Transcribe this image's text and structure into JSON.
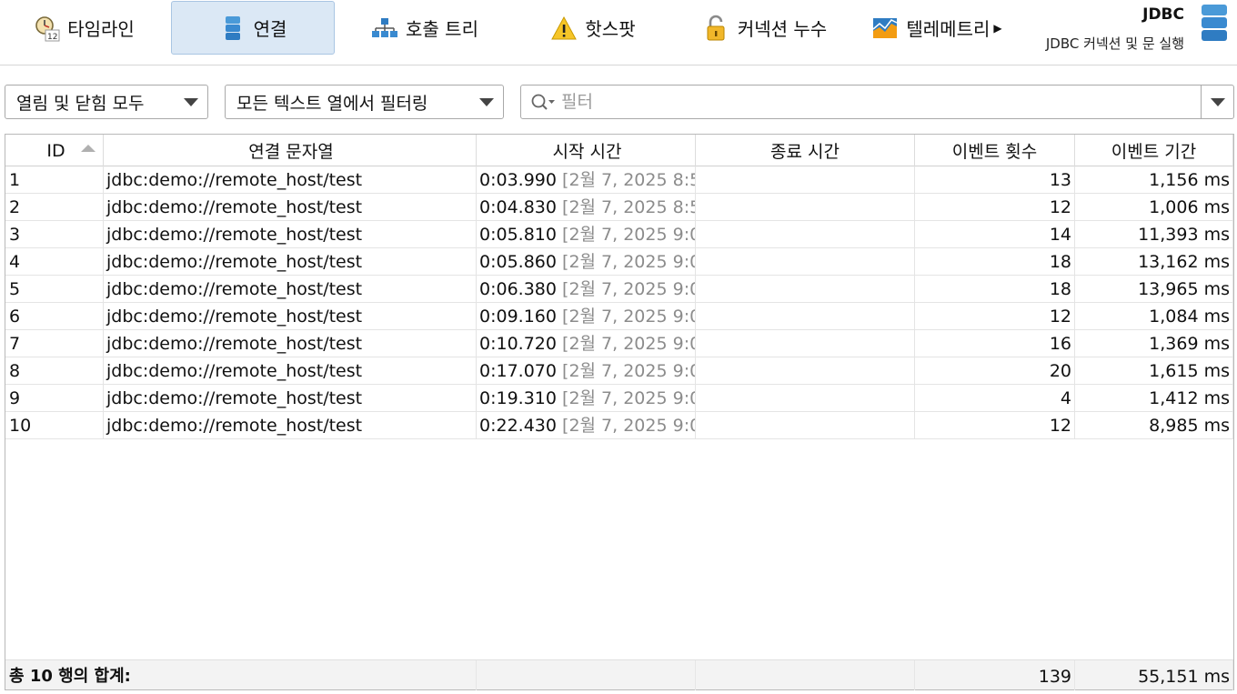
{
  "toolbar": {
    "tabs": [
      {
        "label": "타임라인",
        "icon": "timeline-clock-icon"
      },
      {
        "label": "연결",
        "icon": "database-icon",
        "selected": true
      },
      {
        "label": "호출 트리",
        "icon": "call-tree-icon"
      },
      {
        "label": "핫스팟",
        "icon": "warning-icon"
      },
      {
        "label": "커넥션 누수",
        "icon": "unlocked-padlock-icon"
      },
      {
        "label": "텔레메트리",
        "icon": "telemetry-chart-icon",
        "has_submenu": true
      }
    ],
    "probe_title": "JDBC",
    "probe_subtitle": "JDBC 커넥션 및 문 실행",
    "probe_icon": "database-stack-icon"
  },
  "filters": {
    "open_close_filter": "열림 및 닫힘 모두",
    "column_filter": "모든 텍스트 열에서 필터링",
    "search_placeholder": "필터",
    "search_value": ""
  },
  "table": {
    "columns": [
      "ID",
      "연결 문자열",
      "시작 시간",
      "종료 시간",
      "이벤트 횟수",
      "이벤트 기간"
    ],
    "sorted_column": "ID",
    "sort_direction": "ascending",
    "rows": [
      {
        "id": "1",
        "url": "jdbc:demo://remote_host/test",
        "start": "0:03.990",
        "start_date": "[2월 7, 2025 8:5...",
        "end": "",
        "count": "13",
        "duration": "1,156 ms"
      },
      {
        "id": "2",
        "url": "jdbc:demo://remote_host/test",
        "start": "0:04.830",
        "start_date": "[2월 7, 2025 8:5...",
        "end": "",
        "count": "12",
        "duration": "1,006 ms"
      },
      {
        "id": "3",
        "url": "jdbc:demo://remote_host/test",
        "start": "0:05.810",
        "start_date": "[2월 7, 2025 9:0...",
        "end": "",
        "count": "14",
        "duration": "11,393 ms"
      },
      {
        "id": "4",
        "url": "jdbc:demo://remote_host/test",
        "start": "0:05.860",
        "start_date": "[2월 7, 2025 9:0...",
        "end": "",
        "count": "18",
        "duration": "13,162 ms"
      },
      {
        "id": "5",
        "url": "jdbc:demo://remote_host/test",
        "start": "0:06.380",
        "start_date": "[2월 7, 2025 9:0...",
        "end": "",
        "count": "18",
        "duration": "13,965 ms"
      },
      {
        "id": "6",
        "url": "jdbc:demo://remote_host/test",
        "start": "0:09.160",
        "start_date": "[2월 7, 2025 9:0...",
        "end": "",
        "count": "12",
        "duration": "1,084 ms"
      },
      {
        "id": "7",
        "url": "jdbc:demo://remote_host/test",
        "start": "0:10.720",
        "start_date": "[2월 7, 2025 9:0...",
        "end": "",
        "count": "16",
        "duration": "1,369 ms"
      },
      {
        "id": "8",
        "url": "jdbc:demo://remote_host/test",
        "start": "0:17.070",
        "start_date": "[2월 7, 2025 9:0...",
        "end": "",
        "count": "20",
        "duration": "1,615 ms"
      },
      {
        "id": "9",
        "url": "jdbc:demo://remote_host/test",
        "start": "0:19.310",
        "start_date": "[2월 7, 2025 9:0...",
        "end": "",
        "count": "4",
        "duration": "1,412 ms"
      },
      {
        "id": "10",
        "url": "jdbc:demo://remote_host/test",
        "start": "0:22.430",
        "start_date": "[2월 7, 2025 9:0...",
        "end": "",
        "count": "12",
        "duration": "8,985 ms"
      }
    ],
    "footer": {
      "label": "총 10 행의 합계:",
      "total_count": "139",
      "total_duration": "55,151 ms"
    }
  }
}
